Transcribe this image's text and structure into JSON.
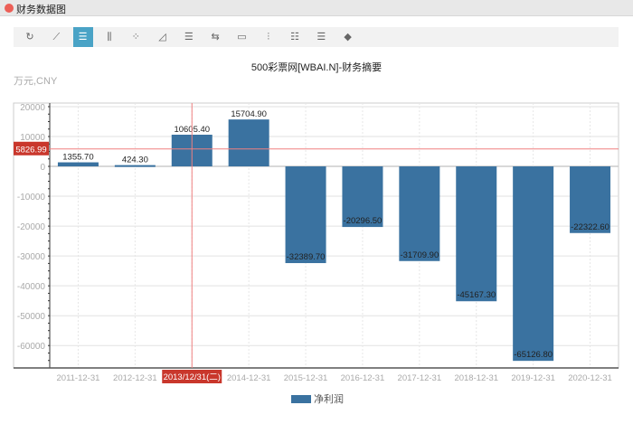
{
  "window": {
    "title": "财务数据图"
  },
  "toolbar": {
    "icons": [
      "refresh-icon",
      "line-chart-icon",
      "bar-chart-icon",
      "column-chart-icon",
      "scatter-icon",
      "area-chart-icon",
      "horizontal-bar-icon",
      "swap-icon",
      "comment-icon",
      "stack-icon",
      "list-icon",
      "table-icon",
      "paint-bucket-icon"
    ],
    "active": 2
  },
  "chart_data": {
    "type": "bar",
    "title": "500彩票网[WBAI.N]-财务摘要",
    "ylabel": "万元,CNY",
    "categories": [
      "2011-12-31",
      "2012-12-31",
      "2013-12-31",
      "2014-12-31",
      "2015-12-31",
      "2016-12-31",
      "2017-12-31",
      "2018-12-31",
      "2019-12-31",
      "2020-12-31"
    ],
    "series": [
      {
        "name": "净利润",
        "color": "#3a72a0",
        "values": [
          1355.7,
          424.3,
          10605.4,
          15704.9,
          -32389.7,
          -20296.5,
          -31709.9,
          -45167.3,
          -65126.8,
          -22322.6
        ]
      }
    ],
    "value_labels": [
      "1355.70",
      "424.30",
      "10605.40",
      "15704.90",
      "-32389.70",
      "-20296.50",
      "-31709.90",
      "-45167.30",
      "-65126.80",
      "-22322.60"
    ],
    "yticks": [
      "20000",
      "10000",
      "0",
      "-10000",
      "-20000",
      "-30000",
      "-40000",
      "-50000",
      "-60000"
    ],
    "ytick_values": [
      20000,
      10000,
      0,
      -10000,
      -20000,
      -30000,
      -40000,
      -50000,
      -60000
    ],
    "ylim": [
      -67500,
      21200
    ],
    "grid": true,
    "legend": "bottom-center",
    "crosshair": {
      "y_label": "5826.99",
      "y_value": 5826.99,
      "x_label": "2013/12/31(二)",
      "x_index": 2
    }
  }
}
